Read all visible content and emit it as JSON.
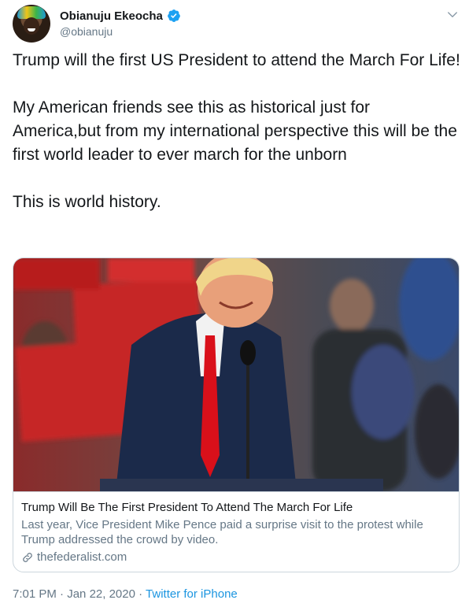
{
  "author": {
    "name": "Obianuju Ekeocha",
    "handle": "@obianuju",
    "verified": true
  },
  "tweet": {
    "paragraphs": [
      "Trump will the first US President to attend the March For Life!",
      "My American friends see this as historical just for America,but from my international perspective this will be the first world leader to ever march for the unborn",
      "This is world history."
    ]
  },
  "card": {
    "title": "Trump Will Be The First President To Attend The March For Life",
    "description": "Last year, Vice President Mike Pence paid a surprise visit to the protest while Trump addressed the crowd by video.",
    "domain": "thefederalist.com",
    "image_icon": "photo-of-speaker-at-podium"
  },
  "meta": {
    "time": "7:01 PM",
    "separator": "·",
    "date": "Jan 22, 2020",
    "source": "Twitter for iPhone"
  },
  "colors": {
    "link": "#1b95e0",
    "secondary_text": "#657786",
    "border": "#ccd6dd",
    "verified": "#1da1f2"
  }
}
